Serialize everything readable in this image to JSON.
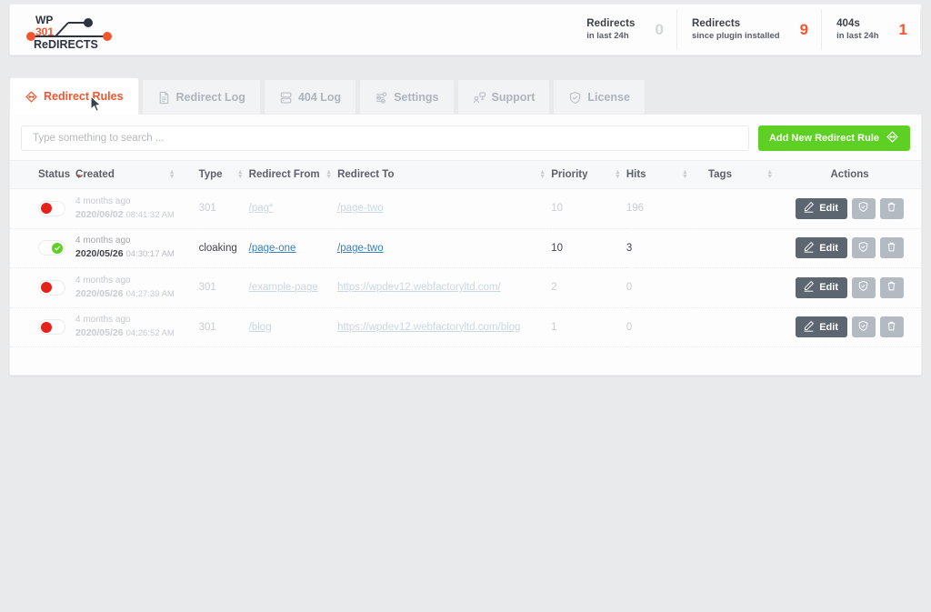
{
  "brand": {
    "wp": "WP",
    "num": "301",
    "name": "ReDIRECTS"
  },
  "stats": [
    {
      "title": "Redirects",
      "sub": "in last 24h",
      "value": "0",
      "tone": "gray"
    },
    {
      "title": "Redirects",
      "sub": "since plugin installed",
      "value": "9",
      "tone": "orange"
    },
    {
      "title": "404s",
      "sub": "in last 24h",
      "value": "1",
      "tone": "orange"
    }
  ],
  "tabs": [
    {
      "label": "Redirect Rules",
      "icon": "redirect-diamond-icon",
      "active": true
    },
    {
      "label": "Redirect Log",
      "icon": "document-icon",
      "active": false
    },
    {
      "label": "404 Log",
      "icon": "database-icon",
      "active": false
    },
    {
      "label": "Settings",
      "icon": "sliders-icon",
      "active": false
    },
    {
      "label": "Support",
      "icon": "support-person-icon",
      "active": false
    },
    {
      "label": "License",
      "icon": "shield-check-icon",
      "active": false
    }
  ],
  "search": {
    "placeholder": "Type something to search ...",
    "value": ""
  },
  "add_button": {
    "label": "Add New Redirect Rule"
  },
  "table": {
    "columns": [
      {
        "label": "Status",
        "sortable": true,
        "sorted": true
      },
      {
        "label": "Created",
        "sortable": true,
        "sorted": false
      },
      {
        "label": "Type",
        "sortable": true,
        "sorted": false
      },
      {
        "label": "Redirect From",
        "sortable": true,
        "sorted": false
      },
      {
        "label": "Redirect To",
        "sortable": true,
        "sorted": false
      },
      {
        "label": "Priority",
        "sortable": true,
        "sorted": false
      },
      {
        "label": "Hits",
        "sortable": true,
        "sorted": false
      },
      {
        "label": "Tags",
        "sortable": true,
        "sorted": false
      },
      {
        "label": "Actions",
        "sortable": false,
        "sorted": false
      }
    ],
    "rows": [
      {
        "status": "off",
        "ago": "4 months ago",
        "date": "2020/06/02",
        "time": "08:41:32 AM",
        "type": "301",
        "from": "/pag*",
        "to": "/page-two",
        "priority": "10",
        "hits": "196",
        "tags": ""
      },
      {
        "status": "on",
        "ago": "4 months ago",
        "date": "2020/05/26",
        "time": "04:30:17 AM",
        "type": "cloaking",
        "from": "/page-one",
        "to": "/page-two",
        "priority": "10",
        "hits": "3",
        "tags": ""
      },
      {
        "status": "off",
        "ago": "4 months ago",
        "date": "2020/05/26",
        "time": "04:27:39 AM",
        "type": "301",
        "from": "/example-page",
        "to": "https://wpdev12.webfactoryltd.com/",
        "priority": "2",
        "hits": "0",
        "tags": ""
      },
      {
        "status": "off",
        "ago": "4 months ago",
        "date": "2020/05/26",
        "time": "04:26:52 AM",
        "type": "301",
        "from": "/blog",
        "to": "https://wpdev12.webfactoryltd.com/blog",
        "priority": "1",
        "hits": "0",
        "tags": ""
      }
    ],
    "row_actions": {
      "edit_label": "Edit",
      "check_icon": "shield-check-icon",
      "delete_icon": "trash-icon"
    }
  },
  "colors": {
    "accent": "#f4552f",
    "green": "#5ed024",
    "red": "#e8201a",
    "dark": "#5b6671"
  }
}
